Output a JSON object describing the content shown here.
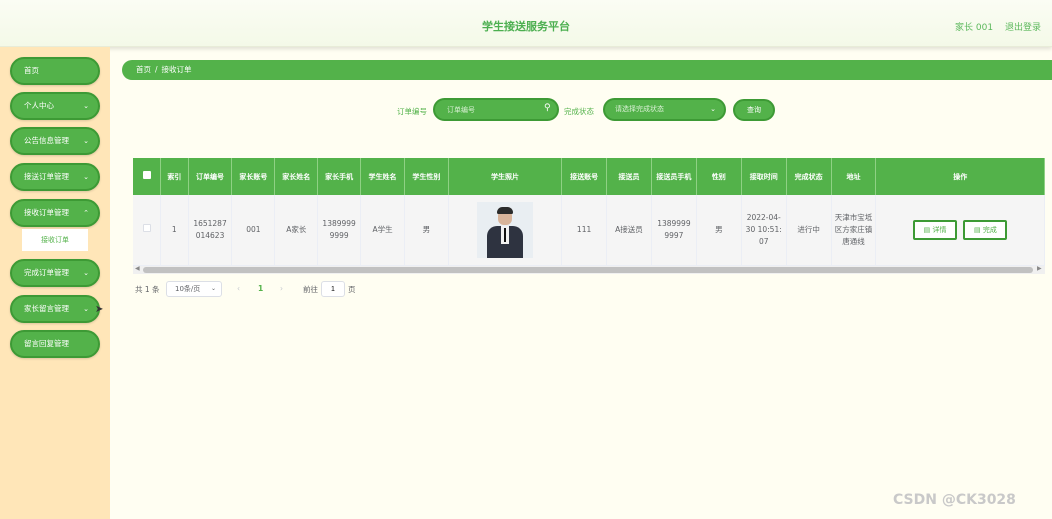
{
  "header": {
    "title": "学生接送服务平台",
    "user": "家长 001",
    "logout": "退出登录"
  },
  "sidebar": {
    "items": [
      {
        "label": "首页",
        "has_chevron": false
      },
      {
        "label": "个人中心",
        "has_chevron": true
      },
      {
        "label": "公告信息管理",
        "has_chevron": true
      },
      {
        "label": "接送订单管理",
        "has_chevron": true
      },
      {
        "label": "接收订单管理",
        "has_chevron": true
      },
      {
        "label": "完成订单管理",
        "has_chevron": true
      },
      {
        "label": "家长留言管理",
        "has_chevron": true
      },
      {
        "label": "留言回复管理",
        "has_chevron": false
      }
    ],
    "submenu_active": "接收订单",
    "chevron_icon": "chevron-down-icon"
  },
  "breadcrumb": {
    "home": "首页",
    "separator": "/",
    "current": "接收订单"
  },
  "search": {
    "order_label": "订单编号",
    "order_placeholder": "订单编号",
    "status_label": "完成状态",
    "status_placeholder": "请选择完成状态",
    "query_button": "查询"
  },
  "table": {
    "headers": [
      "",
      "索引",
      "订单编号",
      "家长账号",
      "家长姓名",
      "家长手机",
      "学生姓名",
      "学生性别",
      "学生照片",
      "接送账号",
      "接送员",
      "接送员手机",
      "性别",
      "接取时间",
      "完成状态",
      "地址",
      "操作"
    ],
    "rows": [
      {
        "index": "1",
        "order_no": "1651287014623",
        "parent_account": "001",
        "parent_name": "A家长",
        "parent_phone": "13899999999",
        "student_name": "A学生",
        "student_gender": "男",
        "pickup_account": "111",
        "pickup_person": "A接送员",
        "pickup_phone": "13899999997",
        "gender": "男",
        "pickup_time": "2022-04-30 10:51:07",
        "status": "进行中",
        "address": "天津市宝坻区方家庄镇唐通线",
        "detail_button": "详情",
        "complete_button": "完成"
      }
    ]
  },
  "pagination": {
    "total": "共 1 条",
    "page_size": "10条/页",
    "prev": "‹",
    "current_page": "1",
    "next": "›",
    "goto_label": "前往",
    "goto_value": "1",
    "goto_suffix": "页"
  },
  "watermark": "CSDN @CK3028",
  "colors": {
    "primary": "#53b24a",
    "sidebar_bg": "#ffe6b8",
    "page_bg": "#fffef2"
  }
}
